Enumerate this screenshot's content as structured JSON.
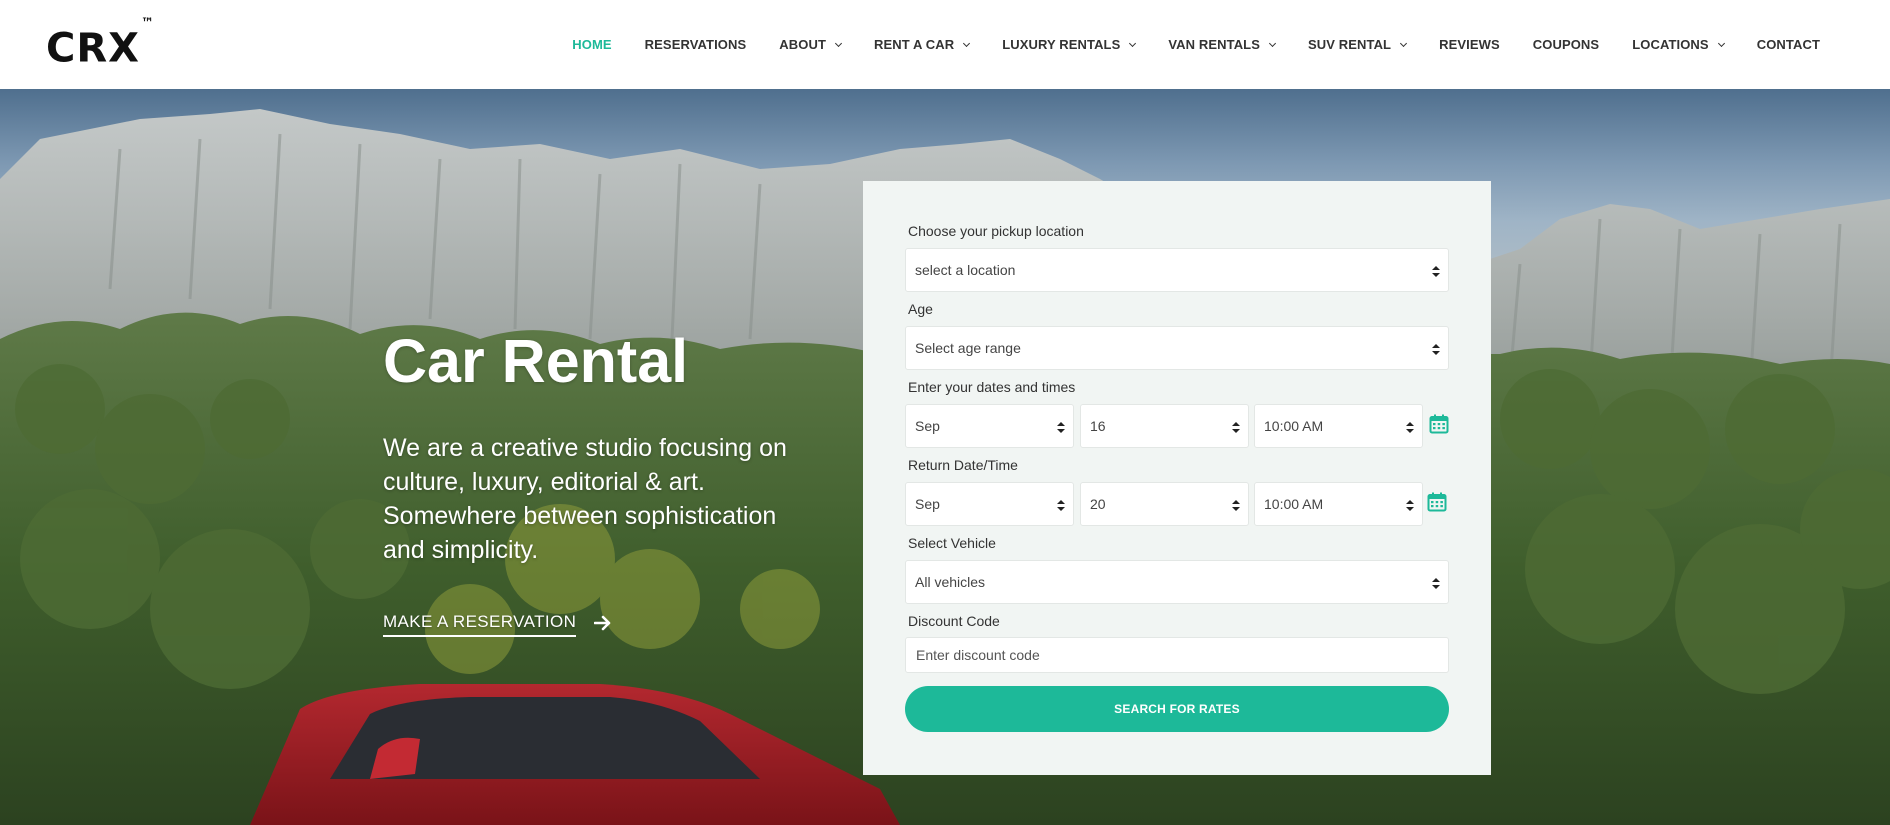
{
  "brand": {
    "logo_text": "CRX",
    "logo_mark": "™",
    "accent_color": "#1db999"
  },
  "nav": {
    "items": [
      {
        "label": "HOME",
        "active": true,
        "has_dropdown": false
      },
      {
        "label": "RESERVATIONS",
        "active": false,
        "has_dropdown": false
      },
      {
        "label": "ABOUT",
        "active": false,
        "has_dropdown": true
      },
      {
        "label": "RENT A CAR",
        "active": false,
        "has_dropdown": true
      },
      {
        "label": "LUXURY RENTALS",
        "active": false,
        "has_dropdown": true
      },
      {
        "label": "VAN RENTALS",
        "active": false,
        "has_dropdown": true
      },
      {
        "label": "SUV RENTAL",
        "active": false,
        "has_dropdown": true
      },
      {
        "label": "REVIEWS",
        "active": false,
        "has_dropdown": false
      },
      {
        "label": "COUPONS",
        "active": false,
        "has_dropdown": false
      },
      {
        "label": "LOCATIONS",
        "active": false,
        "has_dropdown": true
      },
      {
        "label": "CONTACT",
        "active": false,
        "has_dropdown": false
      }
    ]
  },
  "hero": {
    "title": "Car Rental",
    "description": "We are a creative studio focusing on culture, luxury, editorial & art. Somewhere between sophistication and simplicity.",
    "cta_label": "MAKE A RESERVATION",
    "cta_icon": "arrow-right-icon"
  },
  "form": {
    "pickup_label": "Choose your pickup location",
    "pickup_value": "select a location",
    "age_label": "Age",
    "age_value": "Select age range",
    "dates_label": "Enter your dates and times",
    "pickup_month": "Sep",
    "pickup_day": "16",
    "pickup_time": "10:00 AM",
    "return_label": "Return Date/Time",
    "return_month": "Sep",
    "return_day": "20",
    "return_time": "10:00 AM",
    "vehicle_label": "Select Vehicle",
    "vehicle_value": "All vehicles",
    "discount_label": "Discount Code",
    "discount_placeholder": "Enter discount code",
    "submit_label": "SEARCH FOR RATES",
    "calendar_icon": "calendar-icon"
  }
}
